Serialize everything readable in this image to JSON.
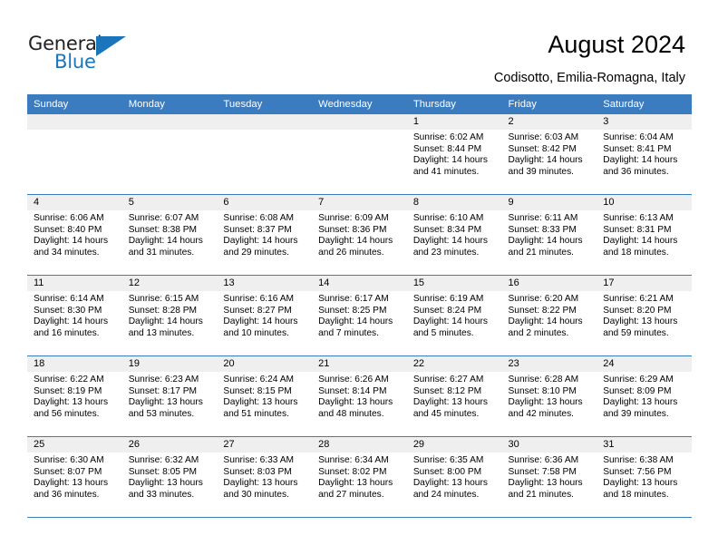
{
  "brand": {
    "name_part1": "General",
    "name_part2": "Blue"
  },
  "header": {
    "title": "August 2024",
    "subtitle": "Codisotto, Emilia-Romagna, Italy"
  },
  "colors": {
    "header_blue": "#3b7cc0",
    "logo_blue": "#1b75bb",
    "date_band": "#efefef"
  },
  "weekdays": [
    "Sunday",
    "Monday",
    "Tuesday",
    "Wednesday",
    "Thursday",
    "Friday",
    "Saturday"
  ],
  "weeks": [
    [
      {
        "day": "",
        "sunrise": "",
        "sunset": "",
        "daylight1": "",
        "daylight2": ""
      },
      {
        "day": "",
        "sunrise": "",
        "sunset": "",
        "daylight1": "",
        "daylight2": ""
      },
      {
        "day": "",
        "sunrise": "",
        "sunset": "",
        "daylight1": "",
        "daylight2": ""
      },
      {
        "day": "",
        "sunrise": "",
        "sunset": "",
        "daylight1": "",
        "daylight2": ""
      },
      {
        "day": "1",
        "sunrise": "Sunrise: 6:02 AM",
        "sunset": "Sunset: 8:44 PM",
        "daylight1": "Daylight: 14 hours",
        "daylight2": "and 41 minutes."
      },
      {
        "day": "2",
        "sunrise": "Sunrise: 6:03 AM",
        "sunset": "Sunset: 8:42 PM",
        "daylight1": "Daylight: 14 hours",
        "daylight2": "and 39 minutes."
      },
      {
        "day": "3",
        "sunrise": "Sunrise: 6:04 AM",
        "sunset": "Sunset: 8:41 PM",
        "daylight1": "Daylight: 14 hours",
        "daylight2": "and 36 minutes."
      }
    ],
    [
      {
        "day": "4",
        "sunrise": "Sunrise: 6:06 AM",
        "sunset": "Sunset: 8:40 PM",
        "daylight1": "Daylight: 14 hours",
        "daylight2": "and 34 minutes."
      },
      {
        "day": "5",
        "sunrise": "Sunrise: 6:07 AM",
        "sunset": "Sunset: 8:38 PM",
        "daylight1": "Daylight: 14 hours",
        "daylight2": "and 31 minutes."
      },
      {
        "day": "6",
        "sunrise": "Sunrise: 6:08 AM",
        "sunset": "Sunset: 8:37 PM",
        "daylight1": "Daylight: 14 hours",
        "daylight2": "and 29 minutes."
      },
      {
        "day": "7",
        "sunrise": "Sunrise: 6:09 AM",
        "sunset": "Sunset: 8:36 PM",
        "daylight1": "Daylight: 14 hours",
        "daylight2": "and 26 minutes."
      },
      {
        "day": "8",
        "sunrise": "Sunrise: 6:10 AM",
        "sunset": "Sunset: 8:34 PM",
        "daylight1": "Daylight: 14 hours",
        "daylight2": "and 23 minutes."
      },
      {
        "day": "9",
        "sunrise": "Sunrise: 6:11 AM",
        "sunset": "Sunset: 8:33 PM",
        "daylight1": "Daylight: 14 hours",
        "daylight2": "and 21 minutes."
      },
      {
        "day": "10",
        "sunrise": "Sunrise: 6:13 AM",
        "sunset": "Sunset: 8:31 PM",
        "daylight1": "Daylight: 14 hours",
        "daylight2": "and 18 minutes."
      }
    ],
    [
      {
        "day": "11",
        "sunrise": "Sunrise: 6:14 AM",
        "sunset": "Sunset: 8:30 PM",
        "daylight1": "Daylight: 14 hours",
        "daylight2": "and 16 minutes."
      },
      {
        "day": "12",
        "sunrise": "Sunrise: 6:15 AM",
        "sunset": "Sunset: 8:28 PM",
        "daylight1": "Daylight: 14 hours",
        "daylight2": "and 13 minutes."
      },
      {
        "day": "13",
        "sunrise": "Sunrise: 6:16 AM",
        "sunset": "Sunset: 8:27 PM",
        "daylight1": "Daylight: 14 hours",
        "daylight2": "and 10 minutes."
      },
      {
        "day": "14",
        "sunrise": "Sunrise: 6:17 AM",
        "sunset": "Sunset: 8:25 PM",
        "daylight1": "Daylight: 14 hours",
        "daylight2": "and 7 minutes."
      },
      {
        "day": "15",
        "sunrise": "Sunrise: 6:19 AM",
        "sunset": "Sunset: 8:24 PM",
        "daylight1": "Daylight: 14 hours",
        "daylight2": "and 5 minutes."
      },
      {
        "day": "16",
        "sunrise": "Sunrise: 6:20 AM",
        "sunset": "Sunset: 8:22 PM",
        "daylight1": "Daylight: 14 hours",
        "daylight2": "and 2 minutes."
      },
      {
        "day": "17",
        "sunrise": "Sunrise: 6:21 AM",
        "sunset": "Sunset: 8:20 PM",
        "daylight1": "Daylight: 13 hours",
        "daylight2": "and 59 minutes."
      }
    ],
    [
      {
        "day": "18",
        "sunrise": "Sunrise: 6:22 AM",
        "sunset": "Sunset: 8:19 PM",
        "daylight1": "Daylight: 13 hours",
        "daylight2": "and 56 minutes."
      },
      {
        "day": "19",
        "sunrise": "Sunrise: 6:23 AM",
        "sunset": "Sunset: 8:17 PM",
        "daylight1": "Daylight: 13 hours",
        "daylight2": "and 53 minutes."
      },
      {
        "day": "20",
        "sunrise": "Sunrise: 6:24 AM",
        "sunset": "Sunset: 8:15 PM",
        "daylight1": "Daylight: 13 hours",
        "daylight2": "and 51 minutes."
      },
      {
        "day": "21",
        "sunrise": "Sunrise: 6:26 AM",
        "sunset": "Sunset: 8:14 PM",
        "daylight1": "Daylight: 13 hours",
        "daylight2": "and 48 minutes."
      },
      {
        "day": "22",
        "sunrise": "Sunrise: 6:27 AM",
        "sunset": "Sunset: 8:12 PM",
        "daylight1": "Daylight: 13 hours",
        "daylight2": "and 45 minutes."
      },
      {
        "day": "23",
        "sunrise": "Sunrise: 6:28 AM",
        "sunset": "Sunset: 8:10 PM",
        "daylight1": "Daylight: 13 hours",
        "daylight2": "and 42 minutes."
      },
      {
        "day": "24",
        "sunrise": "Sunrise: 6:29 AM",
        "sunset": "Sunset: 8:09 PM",
        "daylight1": "Daylight: 13 hours",
        "daylight2": "and 39 minutes."
      }
    ],
    [
      {
        "day": "25",
        "sunrise": "Sunrise: 6:30 AM",
        "sunset": "Sunset: 8:07 PM",
        "daylight1": "Daylight: 13 hours",
        "daylight2": "and 36 minutes."
      },
      {
        "day": "26",
        "sunrise": "Sunrise: 6:32 AM",
        "sunset": "Sunset: 8:05 PM",
        "daylight1": "Daylight: 13 hours",
        "daylight2": "and 33 minutes."
      },
      {
        "day": "27",
        "sunrise": "Sunrise: 6:33 AM",
        "sunset": "Sunset: 8:03 PM",
        "daylight1": "Daylight: 13 hours",
        "daylight2": "and 30 minutes."
      },
      {
        "day": "28",
        "sunrise": "Sunrise: 6:34 AM",
        "sunset": "Sunset: 8:02 PM",
        "daylight1": "Daylight: 13 hours",
        "daylight2": "and 27 minutes."
      },
      {
        "day": "29",
        "sunrise": "Sunrise: 6:35 AM",
        "sunset": "Sunset: 8:00 PM",
        "daylight1": "Daylight: 13 hours",
        "daylight2": "and 24 minutes."
      },
      {
        "day": "30",
        "sunrise": "Sunrise: 6:36 AM",
        "sunset": "Sunset: 7:58 PM",
        "daylight1": "Daylight: 13 hours",
        "daylight2": "and 21 minutes."
      },
      {
        "day": "31",
        "sunrise": "Sunrise: 6:38 AM",
        "sunset": "Sunset: 7:56 PM",
        "daylight1": "Daylight: 13 hours",
        "daylight2": "and 18 minutes."
      }
    ]
  ]
}
